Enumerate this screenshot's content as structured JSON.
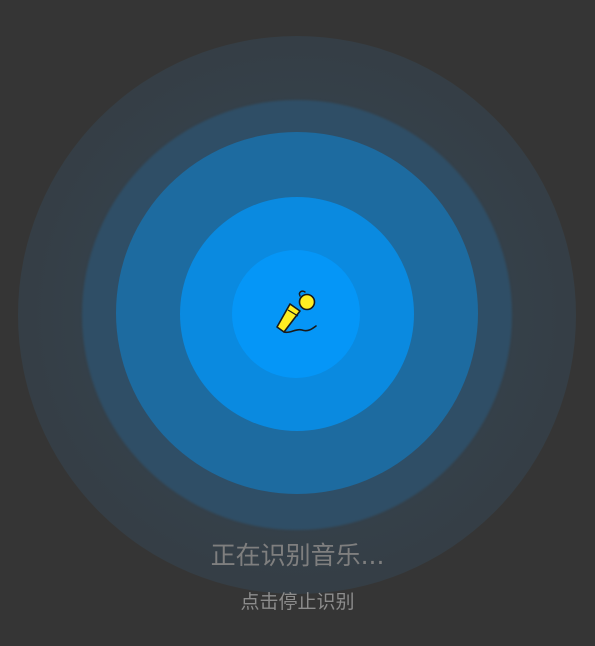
{
  "status": {
    "title": "正在识别音乐...",
    "hint": "点击停止识别"
  },
  "icon": {
    "name": "microphone-icon",
    "fill": "#ffee22",
    "outline": "#1a1a1a"
  },
  "colors": {
    "background": "#353535",
    "core": "#0596f7",
    "inner_ring": "#0a8ae0",
    "mid_ring": "#1d6ba0",
    "halo": "#2f4e66",
    "text_primary": "#7f7f7f",
    "text_secondary": "#8c8c8c"
  }
}
